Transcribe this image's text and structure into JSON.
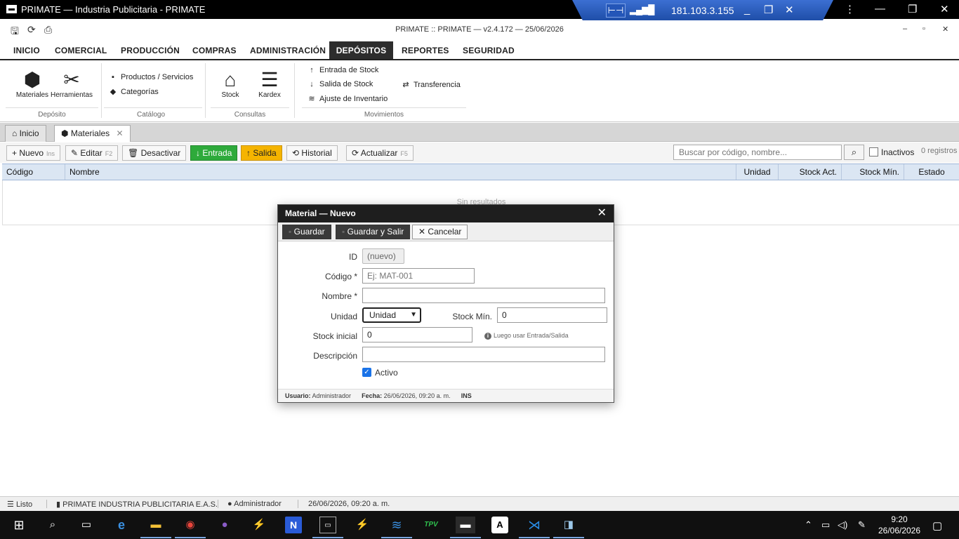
{
  "window": {
    "title": "PRIMATE — Industria Publicitaria - PRIMATE",
    "subtitle": "PRIMATE :: PRIMATE — v2.4.172 — 25/06/2026",
    "remote_ip": "181.103.3.155"
  },
  "menu": [
    "INICIO",
    "COMERCIAL",
    "PRODUCCIÓN",
    "COMPRAS",
    "ADMINISTRACIÓN",
    "DEPÓSITOS",
    "REPORTES",
    "SEGURIDAD"
  ],
  "ribbon": {
    "deposito": {
      "label": "Depósito",
      "materiales": "Materiales",
      "herramientas": "Herramientas"
    },
    "catalogo": {
      "label": "Catálogo",
      "productos": "Productos / Servicios",
      "categorias": "Categorías"
    },
    "consultas": {
      "label": "Consultas",
      "stock": "Stock",
      "kardex": "Kardex"
    },
    "movimientos": {
      "label": "Movimientos",
      "entrada": "Entrada de Stock",
      "salida": "Salida de Stock",
      "ajuste": "Ajuste de Inventario",
      "transferencia": "Transferencia"
    }
  },
  "tabs": {
    "inicio": "Inicio",
    "materiales": "Materiales"
  },
  "toolbar": {
    "nuevo": "Nuevo",
    "nuevo_key": "Ins",
    "editar": "Editar",
    "editar_key": "F2",
    "desactivar": "Desactivar",
    "entrada": "Entrada",
    "salida": "Salida",
    "historial": "Historial",
    "actualizar": "Actualizar",
    "actualizar_key": "F5",
    "search_placeholder": "Buscar por código, nombre...",
    "inactivos": "Inactivos",
    "registros": "0 registros"
  },
  "table": {
    "columns": {
      "codigo": "Código",
      "nombre": "Nombre",
      "unidad": "Unidad",
      "stock_act": "Stock Act.",
      "stock_min": "Stock Mín.",
      "estado": "Estado"
    },
    "empty": "Sin resultados"
  },
  "modal": {
    "title": "Material — Nuevo",
    "guardar": "Guardar",
    "guardar_salir": "Guardar y Salir",
    "cancelar": "Cancelar",
    "fields": {
      "id_label": "ID",
      "id_value": "(nuevo)",
      "codigo_label": "Código *",
      "codigo_placeholder": "Ej: MAT-001",
      "nombre_label": "Nombre *",
      "unidad_label": "Unidad",
      "unidad_value": "Unidad",
      "stock_min_label": "Stock Mín.",
      "stock_min_value": "0",
      "stock_inicial_label": "Stock inicial",
      "stock_inicial_value": "0",
      "stock_hint": "Luego usar Entrada/Salida",
      "descripcion_label": "Descripción",
      "activo_label": "Activo"
    },
    "footer": {
      "usuario_label": "Usuario:",
      "usuario": "Administrador",
      "fecha_label": "Fecha:",
      "fecha": "26/06/2026, 09:20 a. m.",
      "mode": "INS"
    }
  },
  "status": {
    "listo": "Listo",
    "company": "PRIMATE INDUSTRIA PUBLICITARIA E.A.S.",
    "user": "Administrador",
    "datetime": "26/06/2026, 09:20 a. m."
  },
  "taskbar": {
    "time": "9:20",
    "date": "26/06/2026"
  }
}
